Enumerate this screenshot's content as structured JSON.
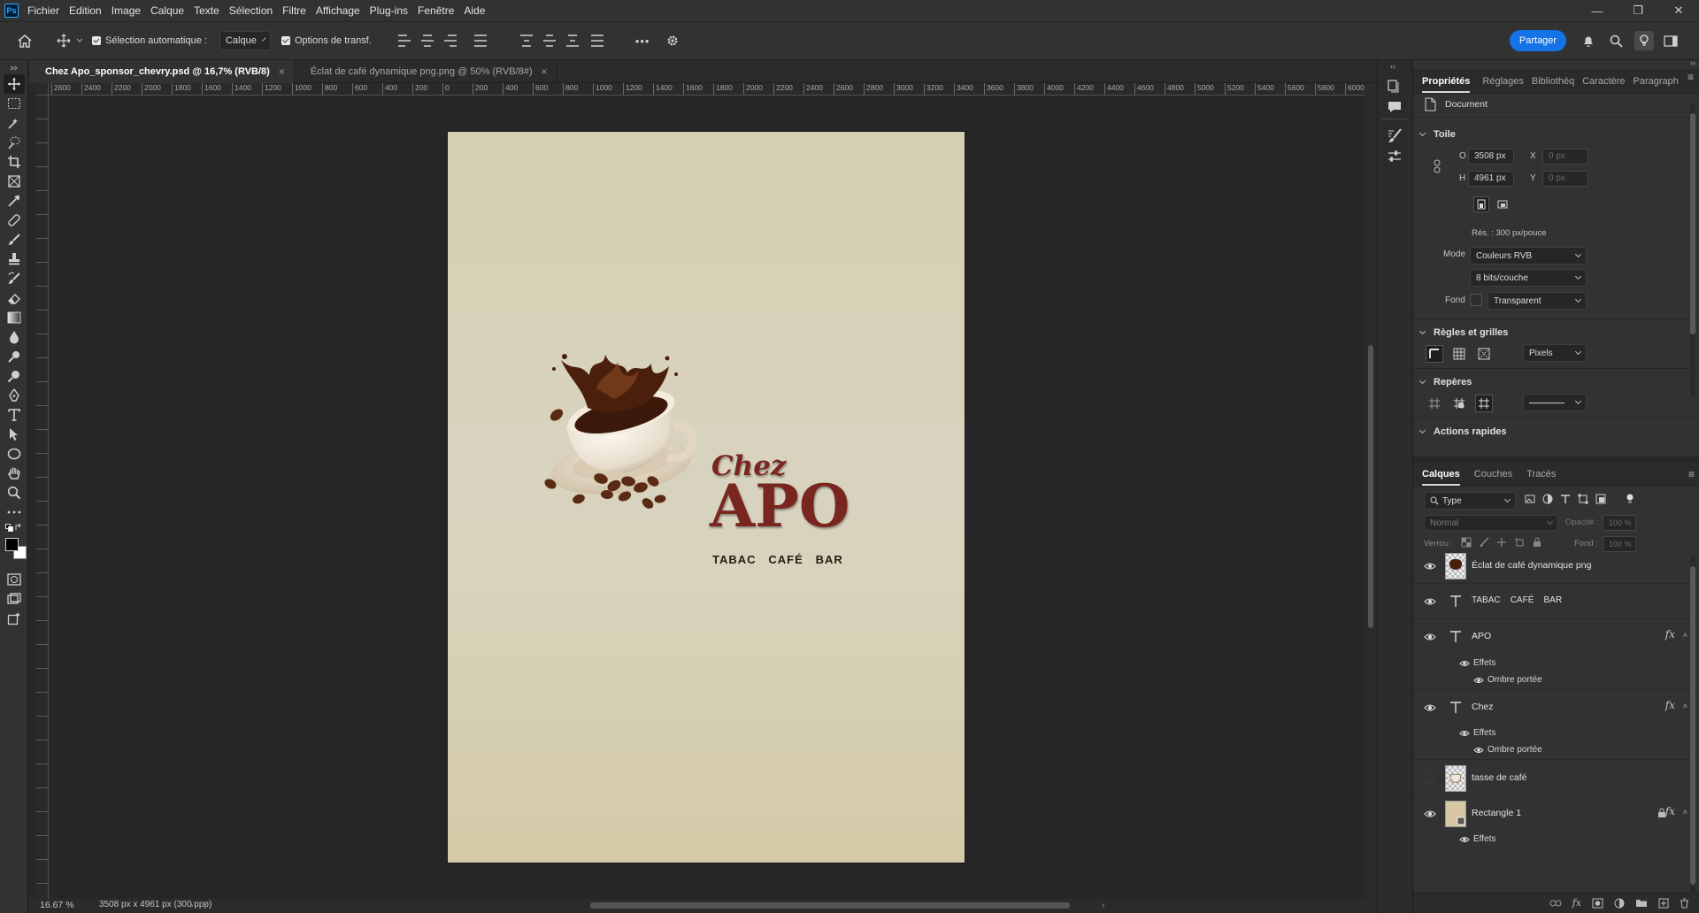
{
  "app": {
    "logo": "Ps",
    "menu": [
      "Fichier",
      "Edition",
      "Image",
      "Calque",
      "Texte",
      "Sélection",
      "Filtre",
      "Affichage",
      "Plug-ins",
      "Fenêtre",
      "Aide"
    ],
    "window_controls": {
      "minimize": "—",
      "restore": "❐",
      "close": "✕"
    }
  },
  "options_bar": {
    "auto_select_label": "Sélection automatique :",
    "auto_select_target": "Calque",
    "transform_label": "Options de transf.",
    "more": "•••",
    "share": "Partager"
  },
  "tabs": [
    {
      "label": "Chez Apo_sponsor_chevry.psd @ 16,7% (RVB/8)",
      "close": "×"
    },
    {
      "label": "Éclat de café dynamique png.png @ 50% (RVB/8#)",
      "close": "×"
    }
  ],
  "ruler_labels": [
    "2600",
    "2400",
    "2200",
    "2000",
    "1800",
    "1600",
    "1400",
    "1200",
    "1000",
    "800",
    "600",
    "400",
    "200",
    "0",
    "200",
    "400",
    "600",
    "800",
    "1000",
    "1200",
    "1400",
    "1600",
    "1800",
    "2000",
    "2200",
    "2400",
    "2600",
    "2800",
    "3000",
    "3200",
    "3400",
    "3600",
    "3800",
    "4000",
    "4200",
    "4400",
    "4600",
    "4800",
    "5000",
    "5200",
    "5400",
    "5600",
    "5800",
    "6000"
  ],
  "artwork": {
    "title_small": "Chez",
    "title_big": "APO",
    "subtitle": "TABAC   CAFÉ   BAR"
  },
  "status": {
    "zoom": "16.67 %",
    "doc_info": "3508 px x 4961 px (300 ppp)"
  },
  "properties_panel": {
    "tabs": [
      "Propriétés",
      "Réglages",
      "Bibliothèq",
      "Caractère",
      "Paragraph"
    ],
    "doc_label": "Document",
    "canvas_section": "Toile",
    "width_label": "O",
    "width_value": "3508 px",
    "height_label": "H",
    "height_value": "4961 px",
    "x_label": "X",
    "x_value": "0 px",
    "y_label": "Y",
    "y_value": "0 px",
    "resolution": "Rés. : 300 px/pouce",
    "mode_label": "Mode",
    "mode_value": "Couleurs RVB",
    "bits_value": "8 bits/couche",
    "fill_label": "Fond",
    "fill_value": "Transparent",
    "rulers_section": "Règles et grilles",
    "units_value": "Pixels",
    "guides_section": "Repères",
    "quick_actions": "Actions rapides"
  },
  "layers_panel": {
    "tabs": [
      "Calques",
      "Couches",
      "Tracés"
    ],
    "filter_type": "Type",
    "blend_mode": "Normal",
    "opacity_label": "Opacité :",
    "opacity_value": "100 %",
    "lock_label": "Verrou :",
    "fill_label": "Fond :",
    "fill_value": "100 %",
    "effects_label": "Effets",
    "drop_shadow_label": "Ombre portée",
    "layers": [
      {
        "name": "Éclat de café dynamique png",
        "kind": "image",
        "visible": true
      },
      {
        "name": "TABAC    CAFÉ    BAR",
        "kind": "text",
        "visible": true
      },
      {
        "name": "APO",
        "kind": "text",
        "visible": true,
        "fx": "fx"
      },
      {
        "name": "Chez",
        "kind": "text",
        "visible": true,
        "fx": "fx"
      },
      {
        "name": "tasse de café",
        "kind": "image",
        "visible": false
      },
      {
        "name": "Rectangle 1",
        "kind": "shape",
        "visible": true,
        "fx": "fx"
      }
    ]
  },
  "colors": {
    "accent": "#1473e6",
    "artboard_top": "#d6cfb1",
    "artboard_bottom": "#d4caa7",
    "title_red": "#7a2620"
  }
}
